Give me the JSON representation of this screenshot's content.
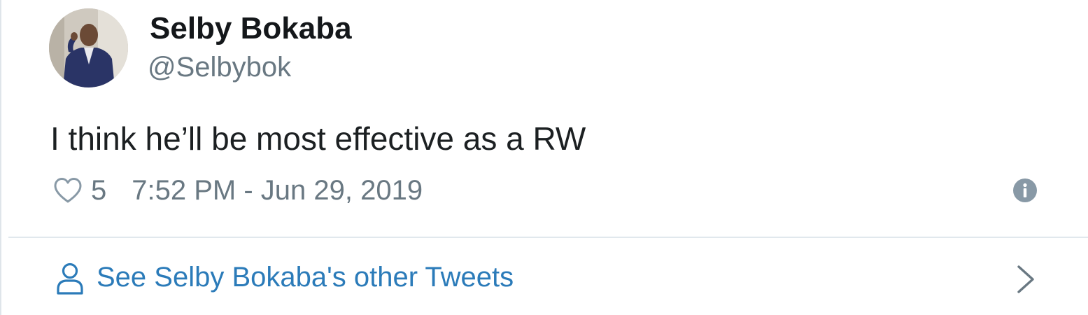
{
  "author": {
    "display_name": "Selby Bokaba",
    "handle": "@Selbybok",
    "avatar_icon": "avatar-photo"
  },
  "tweet": {
    "text": "I think he’ll be most effective as a RW",
    "like_count": "5",
    "timestamp": "7:52 PM - Jun 29, 2019"
  },
  "icons": {
    "like": "heart-icon",
    "info": "info-icon",
    "person": "person-icon",
    "chevron": "chevron-right-icon"
  },
  "footer": {
    "other_tweets_label": "See Selby Bokaba's other Tweets"
  },
  "colors": {
    "name": "#14171a",
    "secondary": "#697882",
    "link": "#2b7bb9",
    "divider": "#e1e8ed",
    "icon_gray": "#8899a6"
  }
}
